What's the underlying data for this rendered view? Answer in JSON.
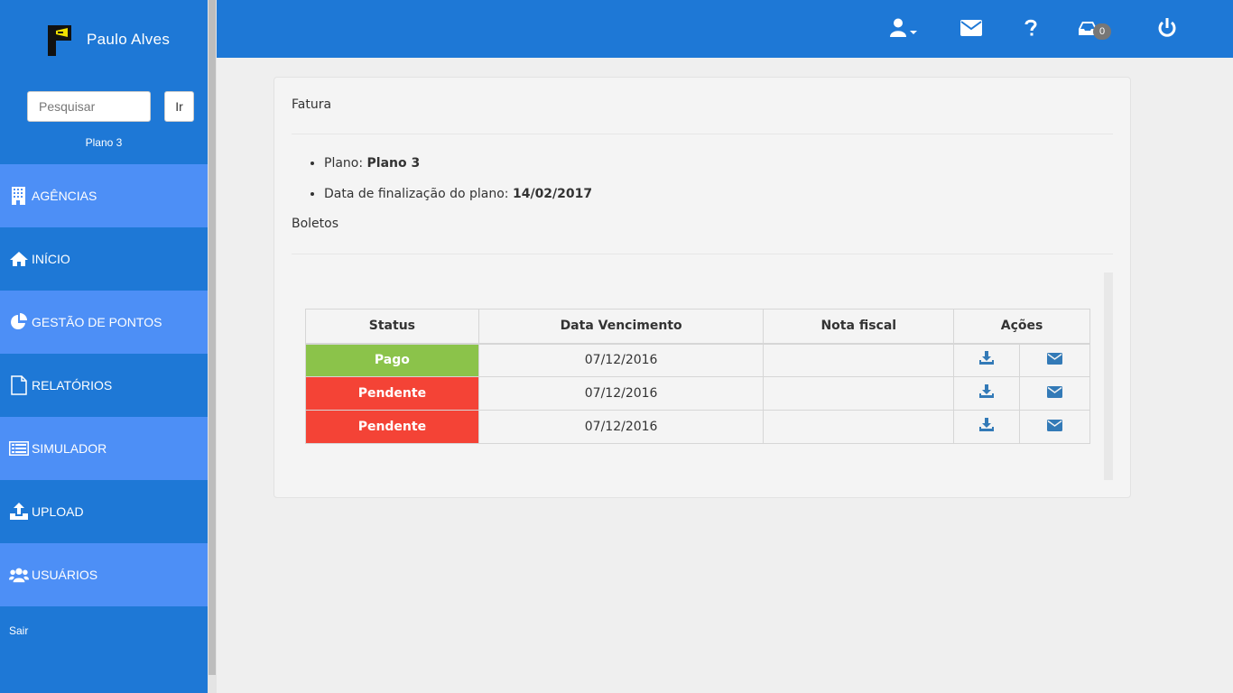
{
  "sidebar": {
    "user_name": "Paulo Alves",
    "search_placeholder": "Pesquisar",
    "search_button": "Ir",
    "plan_label": "Plano 3",
    "items": [
      {
        "label": "AGÊNCIAS",
        "icon": "building-icon"
      },
      {
        "label": "INÍCIO",
        "icon": "home-icon"
      },
      {
        "label": "GESTÃO DE PONTOS",
        "icon": "pie-chart-icon"
      },
      {
        "label": "RELATÓRIOS",
        "icon": "file-icon"
      },
      {
        "label": "SIMULADOR",
        "icon": "list-icon"
      },
      {
        "label": "UPLOAD",
        "icon": "upload-icon"
      },
      {
        "label": "USUÁRIOS",
        "icon": "users-icon"
      }
    ],
    "logout": "Sair"
  },
  "topbar": {
    "inbox_count": "0"
  },
  "panel": {
    "title": "Fatura",
    "plan_prefix": "Plano: ",
    "plan_value": "Plano 3",
    "end_prefix": "Data de finalização do plano: ",
    "end_value": "14/02/2017",
    "boletos_title": "Boletos",
    "table": {
      "headers": [
        "Status",
        "Data Vencimento",
        "Nota fiscal",
        "Ações"
      ],
      "rows": [
        {
          "status": "Pago",
          "due": "07/12/2016",
          "invoice": ""
        },
        {
          "status": "Pendente",
          "due": "07/12/2016",
          "invoice": ""
        },
        {
          "status": "Pendente",
          "due": "07/12/2016",
          "invoice": ""
        }
      ]
    }
  },
  "colors": {
    "primary": "#1e78d6",
    "nav_alt": "#4d8ff6",
    "paid": "#8bc34a",
    "pending": "#f44336",
    "action_icon": "#337ab7"
  }
}
